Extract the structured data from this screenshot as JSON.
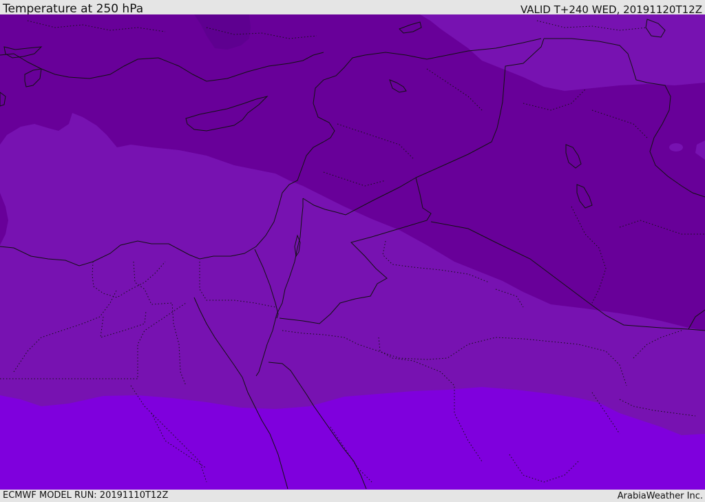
{
  "header": {
    "title": "Temperature at 250 hPa",
    "valid_time": "VALID T+240 WED, 20191120T12Z"
  },
  "footer": {
    "model_run": "ECMWF MODEL RUN: 20191110T12Z",
    "credit": "ArabiaWeather Inc."
  },
  "map": {
    "colors": {
      "band_darkest": "#5e0090",
      "band_dark": "#680099",
      "band_mid": "#7712b1",
      "band_light": "#7f00dd",
      "border_line": "#111111"
    }
  }
}
